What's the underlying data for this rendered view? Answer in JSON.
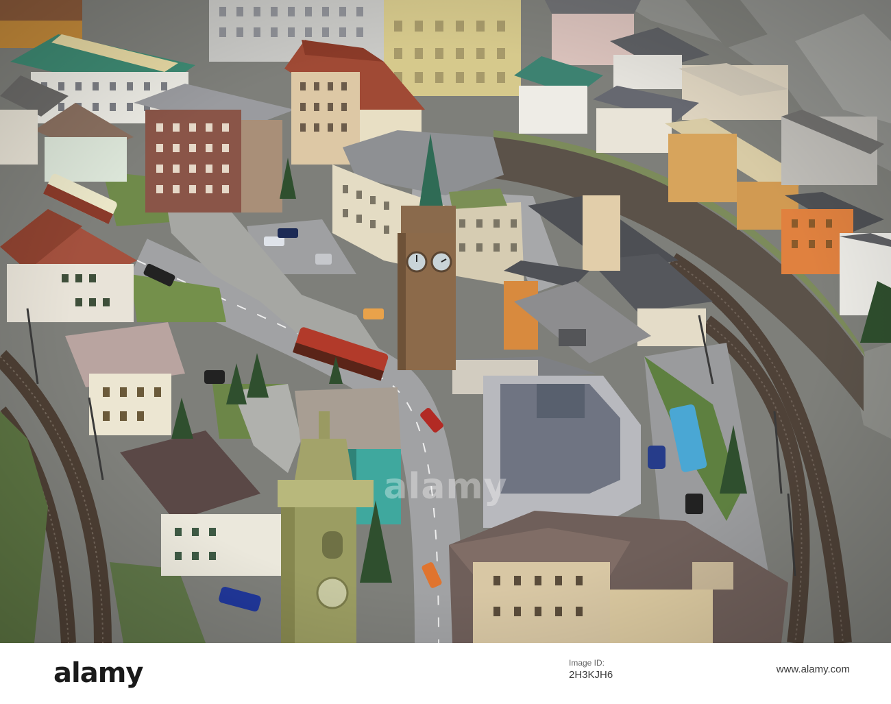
{
  "watermark": {
    "brand": "alamy",
    "image_id_label": "Image ID:",
    "image_id": "2H3KJH6",
    "url": "www.alamy.com"
  },
  "colors": {
    "rock": "#8e8f8b",
    "road": "#9c9d9f",
    "track": "#5a4b3e",
    "grass": "#6f8a4a",
    "roof_red": "#a0523c",
    "roof_green": "#3d8a74",
    "roof_grey": "#6e6f72",
    "tower": "#8a6a4c",
    "spire": "#2f6b55"
  }
}
